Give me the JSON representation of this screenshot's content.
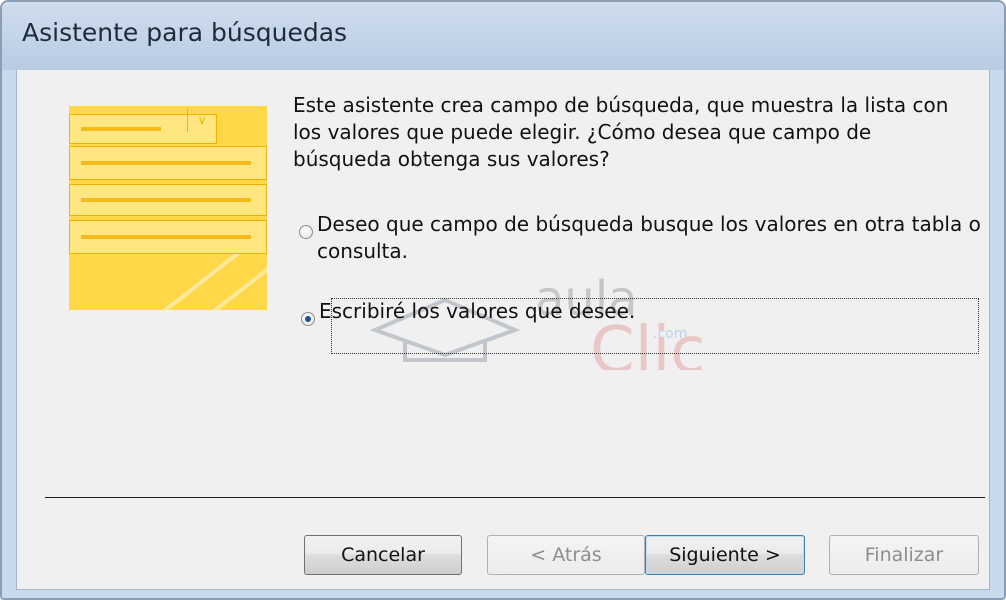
{
  "window": {
    "title": "Asistente para búsquedas"
  },
  "intro_text": "Este asistente crea campo de búsqueda, que muestra la lista con los valores que puede elegir. ¿Cómo desea que campo de búsqueda obtenga sus valores?",
  "options": [
    {
      "line1": "Deseo que campo de búsqueda busque los valores en otra tabla o",
      "line2": "consulta.",
      "selected": false
    },
    {
      "line1": "Escribiré los valores que desee.",
      "selected": true
    }
  ],
  "watermark": {
    "brand": "aula",
    "suffix": ".com",
    "word": "Clic"
  },
  "buttons": {
    "cancel": "Cancelar",
    "back": "< Atrás",
    "next": "Siguiente >",
    "finish": "Finalizar"
  },
  "colors": {
    "title_bar": "#c4d5e9",
    "illustration": "#ffd84a",
    "default_button_border": "#3c7fb1"
  }
}
